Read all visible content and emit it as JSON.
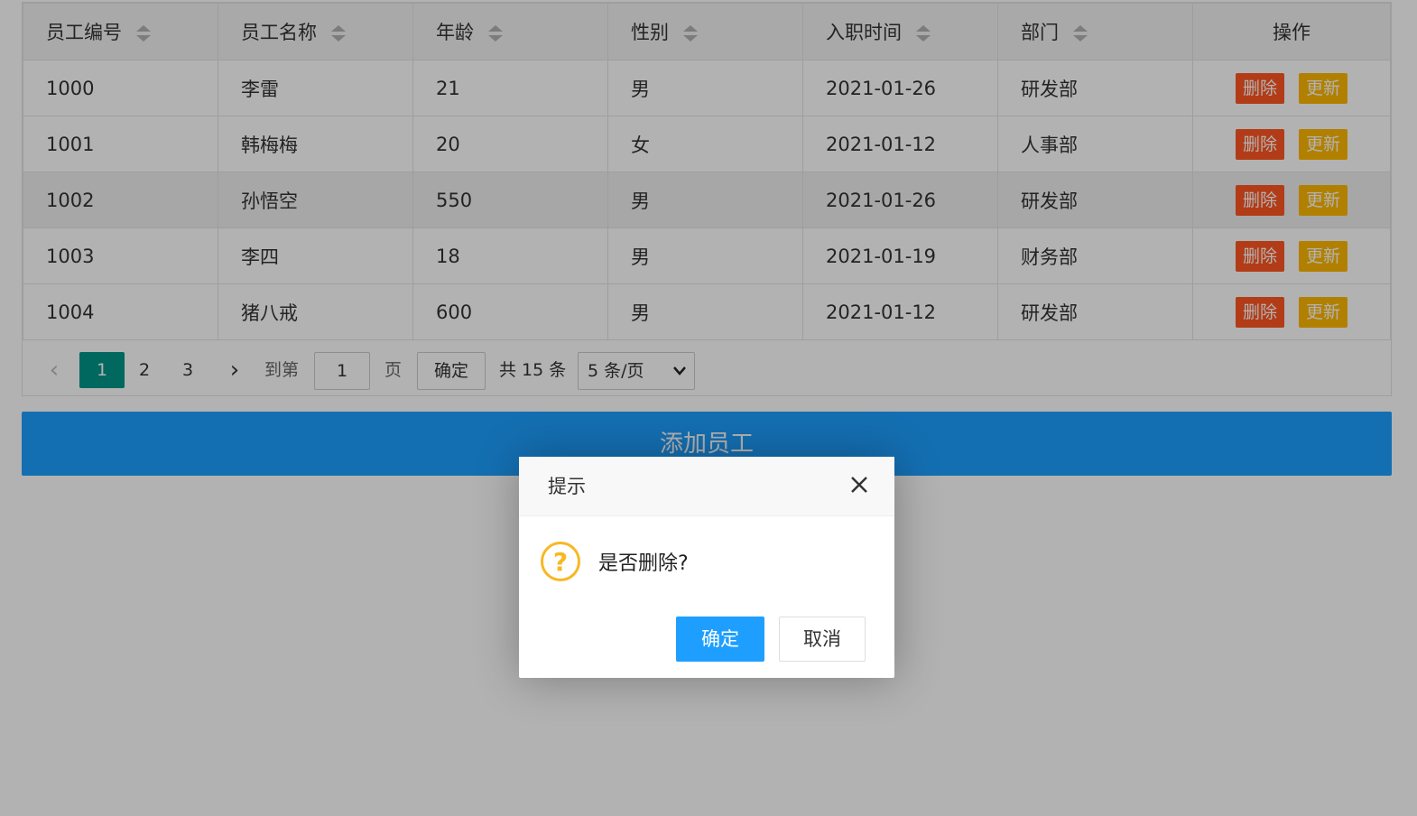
{
  "table": {
    "columns": [
      {
        "label": "员工编号",
        "sortable": true
      },
      {
        "label": "员工名称",
        "sortable": true
      },
      {
        "label": "年龄",
        "sortable": true
      },
      {
        "label": "性别",
        "sortable": true
      },
      {
        "label": "入职时间",
        "sortable": true
      },
      {
        "label": "部门",
        "sortable": true
      },
      {
        "label": "操作",
        "sortable": false
      }
    ],
    "rows": [
      {
        "id": "1000",
        "name": "李雷",
        "age": "21",
        "gender": "男",
        "date": "2021-01-26",
        "dept": "研发部"
      },
      {
        "id": "1001",
        "name": "韩梅梅",
        "age": "20",
        "gender": "女",
        "date": "2021-01-12",
        "dept": "人事部"
      },
      {
        "id": "1002",
        "name": "孙悟空",
        "age": "550",
        "gender": "男",
        "date": "2021-01-26",
        "dept": "研发部"
      },
      {
        "id": "1003",
        "name": "李四",
        "age": "18",
        "gender": "男",
        "date": "2021-01-19",
        "dept": "财务部"
      },
      {
        "id": "1004",
        "name": "猪八戒",
        "age": "600",
        "gender": "男",
        "date": "2021-01-12",
        "dept": "研发部"
      }
    ],
    "delete_label": "删除",
    "update_label": "更新"
  },
  "pager": {
    "prev": "‹",
    "current": "1",
    "page2": "2",
    "page3": "3",
    "next": "›",
    "goto_label": "到第",
    "goto_value": "1",
    "unit_label": "页",
    "confirm_label": "确定",
    "total_label": "共 15 条",
    "page_size": "5 条/页"
  },
  "add_button": "添加员工",
  "dialog": {
    "title": "提示",
    "message": "是否删除?",
    "confirm": "确定",
    "cancel": "取消",
    "icon": "?"
  },
  "colors": {
    "primary": "#1E9FFF",
    "current_page": "#009688",
    "delete": "#FF5722",
    "update": "#FFB800",
    "warn_icon": "#F7B824"
  }
}
